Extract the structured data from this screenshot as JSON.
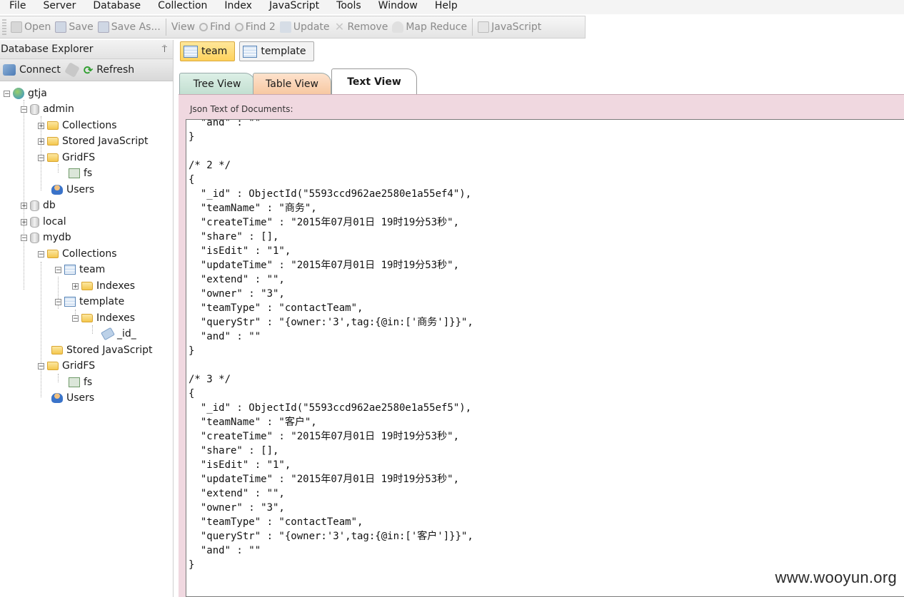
{
  "menu": [
    "File",
    "Server",
    "Database",
    "Collection",
    "Index",
    "JavaScript",
    "Tools",
    "Window",
    "Help"
  ],
  "toolbar": {
    "open": "Open",
    "save": "Save",
    "save_as": "Save As...",
    "view": "View",
    "find": "Find",
    "find2": "Find 2",
    "update": "Update",
    "remove": "Remove",
    "map_reduce": "Map Reduce",
    "javascript": "JavaScript"
  },
  "explorer": {
    "title": "Database Explorer",
    "pin": "⍑",
    "connect": "Connect",
    "refresh": "Refresh",
    "nodes": {
      "gtja": "gtja",
      "admin": "admin",
      "admin_collections": "Collections",
      "admin_stored_js": "Stored JavaScript",
      "admin_gridfs": "GridFS",
      "admin_fs": "fs",
      "admin_users": "Users",
      "db": "db",
      "local": "local",
      "mydb": "mydb",
      "mydb_collections": "Collections",
      "team": "team",
      "team_indexes": "Indexes",
      "template": "template",
      "template_indexes": "Indexes",
      "id_index": "_id_",
      "mydb_stored_js": "Stored JavaScript",
      "mydb_gridfs": "GridFS",
      "mydb_fs": "fs",
      "mydb_users": "Users"
    }
  },
  "doc_tabs": [
    "team",
    "template"
  ],
  "view_tabs": {
    "tree": "Tree View",
    "table": "Table View",
    "text": "Text View"
  },
  "json_label": "Json Text of Documents:",
  "code_lines": [
    "  \"and\" : \"\"",
    "}",
    "",
    "/* 2 */",
    "{",
    "  \"_id\" : ObjectId(\"5593ccd962ae2580e1a55ef4\"),",
    "  \"teamName\" : \"商务\",",
    "  \"createTime\" : \"2015年07月01日 19时19分53秒\",",
    "  \"share\" : [],",
    "  \"isEdit\" : \"1\",",
    "  \"updateTime\" : \"2015年07月01日 19时19分53秒\",",
    "  \"extend\" : \"\",",
    "  \"owner\" : \"3\",",
    "  \"teamType\" : \"contactTeam\",",
    "  \"queryStr\" : \"{owner:'3',tag:{@in:['商务']}}\",",
    "  \"and\" : \"\"",
    "}",
    "",
    "/* 3 */",
    "{",
    "  \"_id\" : ObjectId(\"5593ccd962ae2580e1a55ef5\"),",
    "  \"teamName\" : \"客户\",",
    "  \"createTime\" : \"2015年07月01日 19时19分53秒\",",
    "  \"share\" : [],",
    "  \"isEdit\" : \"1\",",
    "  \"updateTime\" : \"2015年07月01日 19时19分53秒\",",
    "  \"extend\" : \"\",",
    "  \"owner\" : \"3\",",
    "  \"teamType\" : \"contactTeam\",",
    "  \"queryStr\" : \"{owner:'3',tag:{@in:['客户']}}\",",
    "  \"and\" : \"\"",
    "}"
  ],
  "watermark": "www.wooyun.org"
}
